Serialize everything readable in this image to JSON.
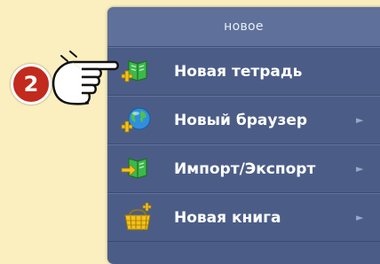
{
  "menu": {
    "header": "новое",
    "items": [
      {
        "label": "Новая тетрадь",
        "icon": "new-notebook-icon",
        "has_submenu": false
      },
      {
        "label": "Новый браузер",
        "icon": "new-browser-globe-icon",
        "has_submenu": true
      },
      {
        "label": "Импорт/Экспорт",
        "icon": "import-export-icon",
        "has_submenu": true
      },
      {
        "label": "Новая книга",
        "icon": "new-book-basket-icon",
        "has_submenu": true
      }
    ],
    "submenu_arrow": "►"
  },
  "callout": {
    "step_number": "2",
    "hand_icon": "pointing-hand-icon"
  },
  "colors": {
    "background": "#fbefbf",
    "menu_bg": "#4b5d87",
    "header_bg": "#5f719a",
    "badge": "#c22a1d",
    "icon_green": "#3cb94a",
    "plus_yellow": "#f3c21b"
  }
}
